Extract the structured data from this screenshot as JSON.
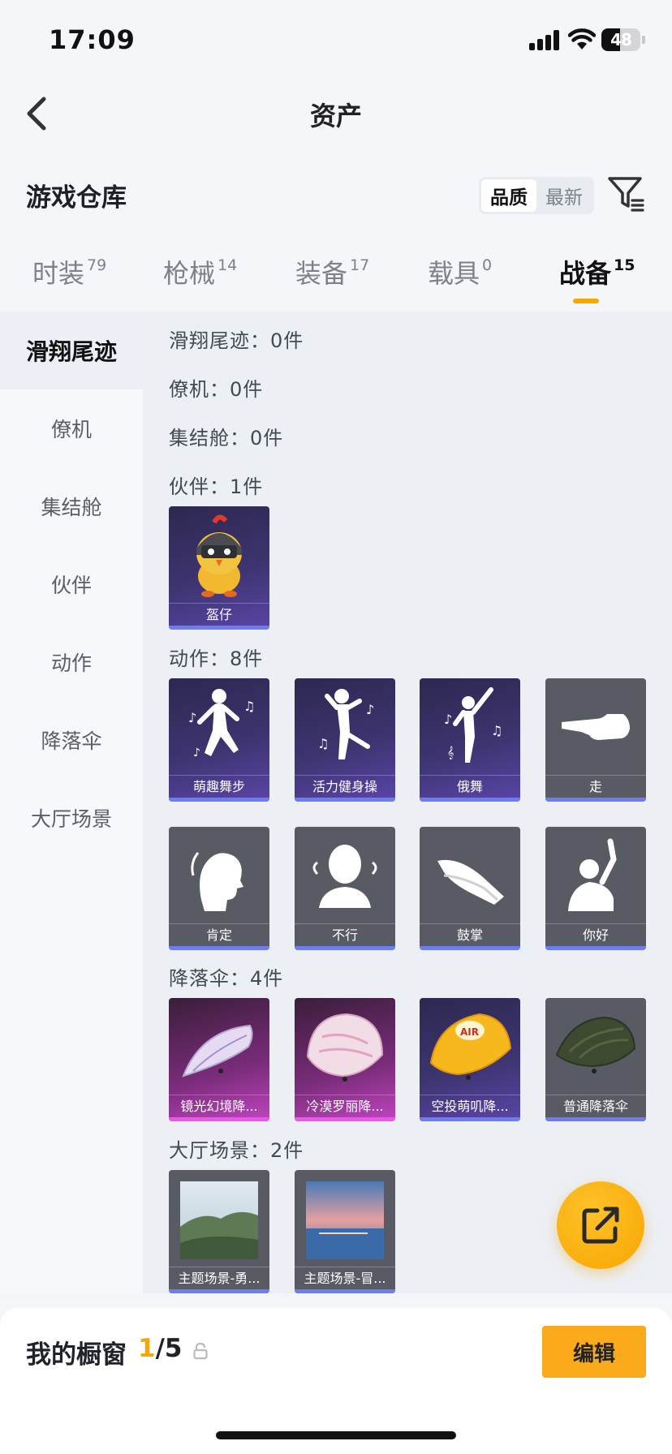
{
  "status": {
    "time": "17:09",
    "battery": "48",
    "battery_level": 0.48
  },
  "nav": {
    "title": "资产"
  },
  "header": {
    "title": "游戏仓库",
    "sort_options": [
      "品质",
      "最新"
    ],
    "active_sort": "品质"
  },
  "tabs": [
    {
      "label": "时装",
      "count": "79"
    },
    {
      "label": "枪械",
      "count": "14"
    },
    {
      "label": "装备",
      "count": "17"
    },
    {
      "label": "载具",
      "count": "0"
    },
    {
      "label": "战备",
      "count": "15",
      "active": true
    }
  ],
  "sidebar": {
    "items": [
      {
        "label": "滑翔尾迹",
        "active": true
      },
      {
        "label": "僚机"
      },
      {
        "label": "集结舱"
      },
      {
        "label": "伙伴"
      },
      {
        "label": "动作"
      },
      {
        "label": "降落伞"
      },
      {
        "label": "大厅场景"
      }
    ]
  },
  "categories": [
    {
      "header": "滑翔尾迹：0件",
      "items": []
    },
    {
      "header": "僚机：0件",
      "items": []
    },
    {
      "header": "集结舱：0件",
      "items": []
    },
    {
      "header": "伙伴：1件",
      "items": [
        {
          "name": "盔仔",
          "rarity": "purple",
          "icon": "chick-helmet-icon"
        }
      ]
    },
    {
      "header": "动作：8件",
      "items": [
        {
          "name": "萌趣舞步",
          "rarity": "purple",
          "icon": "dance-icon"
        },
        {
          "name": "活力健身操",
          "rarity": "purple",
          "icon": "workout-icon"
        },
        {
          "name": "俄舞",
          "rarity": "purple",
          "icon": "ballet-icon"
        },
        {
          "name": "走",
          "rarity": "grey",
          "icon": "pointing-hand-icon"
        },
        {
          "name": "肯定",
          "rarity": "grey",
          "icon": "nod-icon"
        },
        {
          "name": "不行",
          "rarity": "grey",
          "icon": "head-shake-icon"
        },
        {
          "name": "鼓掌",
          "rarity": "grey",
          "icon": "clap-icon"
        },
        {
          "name": "你好",
          "rarity": "grey",
          "icon": "wave-icon"
        }
      ]
    },
    {
      "header": "降落伞：4件",
      "items": [
        {
          "name": "镜光幻境降...",
          "rarity": "pink",
          "icon": "parachute-icon"
        },
        {
          "name": "冷漠罗丽降...",
          "rarity": "pink",
          "icon": "parachute-icon"
        },
        {
          "name": "空投萌叽降...",
          "rarity": "purple",
          "icon": "parachute-icon"
        },
        {
          "name": "普通降落伞",
          "rarity": "grey",
          "icon": "parachute-icon"
        }
      ]
    },
    {
      "header": "大厅场景：2件",
      "items": [
        {
          "name": "主题场景-勇...",
          "rarity": "grey",
          "icon": "landscape-icon"
        },
        {
          "name": "主题场景-冒...",
          "rarity": "grey",
          "icon": "seascape-icon"
        }
      ]
    }
  ],
  "bottom": {
    "label": "我的橱窗",
    "current": "1",
    "total": "/5",
    "edit_label": "编辑"
  },
  "colors": {
    "accent": "#f5a800",
    "purple_bar": "#6e7cf2",
    "pink_bar": "#ee55ea"
  }
}
